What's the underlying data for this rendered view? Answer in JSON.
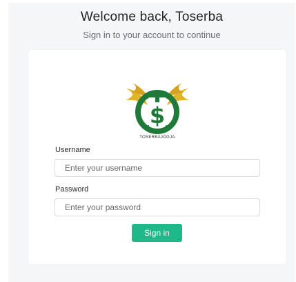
{
  "header": {
    "title": "Welcome back, Toserba",
    "subtitle": "Sign in to your account to continue"
  },
  "logo": {
    "caption": "TOSERBAJOGJA",
    "icon": "toserba-logo-icon",
    "colors": {
      "ring": "#1f7a3a",
      "wings": "#e0b32a",
      "dollar": "#1f7a3a"
    }
  },
  "form": {
    "username": {
      "label": "Username",
      "placeholder": "Enter your username",
      "value": ""
    },
    "password": {
      "label": "Password",
      "placeholder": "Enter your password",
      "value": ""
    },
    "submit_label": "Sign in"
  },
  "colors": {
    "accent": "#1fb888",
    "page_background": "#f5f6f8",
    "card_background": "#ffffff"
  }
}
